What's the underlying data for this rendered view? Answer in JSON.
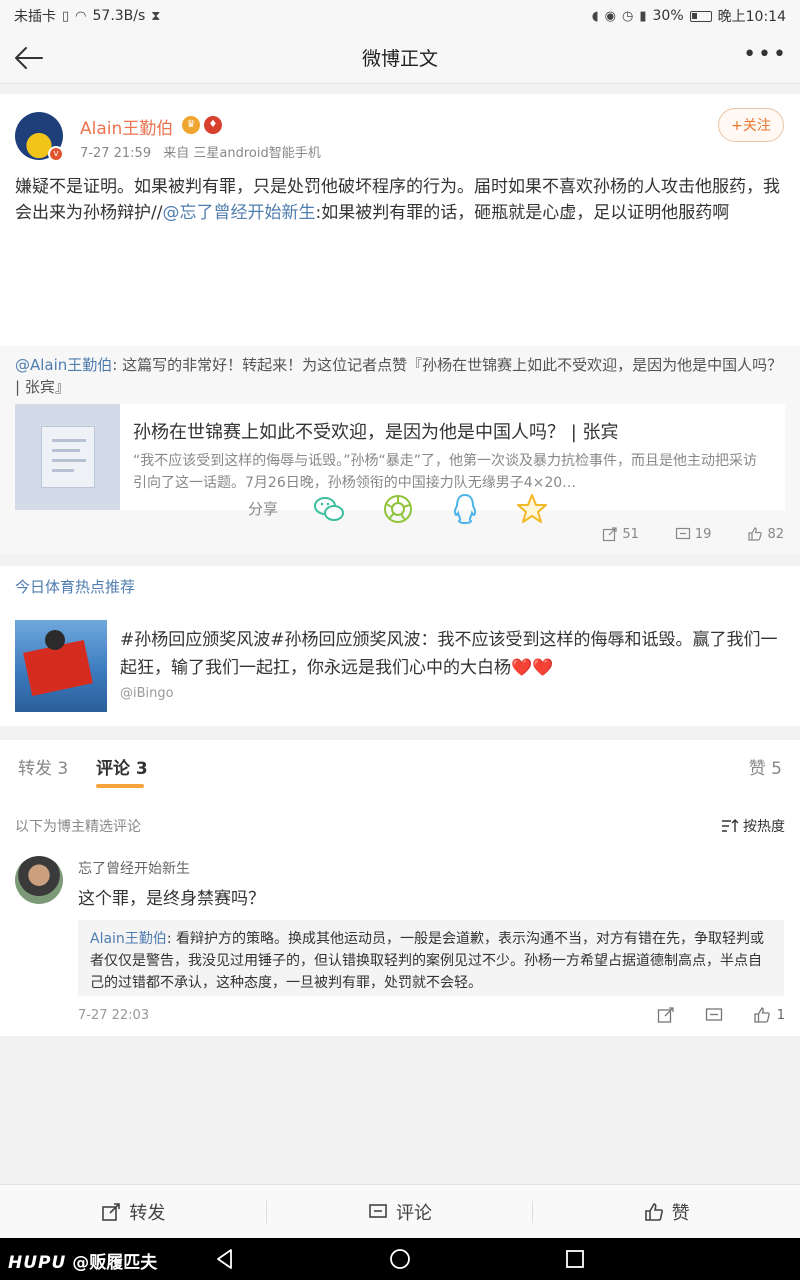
{
  "status_bar": {
    "sim": "未插卡",
    "speed": "57.3B/s",
    "battery_text": "30%",
    "battery_level": 0.3,
    "time": "晚上10:14"
  },
  "nav": {
    "title": "微博正文"
  },
  "post": {
    "username": "Alain王勤伯",
    "time": "7-27 21:59",
    "source": "来自 三星android智能手机",
    "follow_label": "+关注",
    "text_before": "嫌疑不是证明。如果被判有罪，只是处罚他破坏程序的行为。届时如果不喜欢孙杨的人攻击他服药，我会出来为孙杨辩护//",
    "mention": "@忘了曾经开始新生",
    "text_after": ":如果被判有罪的话，砸瓶就是心虚，足以证明他服药啊"
  },
  "repost": {
    "mention": "@Alain王勤伯",
    "text": ": 这篇写的非常好！转起来！为这位记者点赞『孙杨在世锦赛上如此不受欢迎，是因为他是中国人吗？ | 张宾』",
    "card_title": "孙杨在世锦赛上如此不受欢迎，是因为他是中国人吗？ | 张宾",
    "card_desc": "“我不应该受到这样的侮辱与诋毁。”孙杨“暴走”了，他第一次谈及暴力抗检事件，而且是他主动把采访引向了这一话题。7月26日晚，孙杨领衔的中国接力队无缘男子4×20…",
    "reposts": "51",
    "comments": "19",
    "likes": "82"
  },
  "share": {
    "label": "分享"
  },
  "hot": {
    "header": "今日体育热点推荐",
    "text": "#孙杨回应颁奖风波#孙杨回应颁奖风波：我不应该受到这样的侮辱和诋毁。赢了我们一起狂，输了我们一起扛，你永远是我们心中的大白杨❤️❤️",
    "source": "@iBingo"
  },
  "comments": {
    "tab_repost": "转发 3",
    "tab_comment": "评论 3",
    "tab_like": "赞 5",
    "selected_label": "以下为博主精选评论",
    "sort_label": "按热度",
    "user": "忘了曾经开始新生",
    "text": "这个罪，是终身禁赛吗？",
    "reply_user": "Alain王勤伯",
    "reply_text": ": 看辩护方的策略。换成其他运动员，一般是会道歉，表示沟通不当，对方有错在先，争取轻判或者仅仅是警告，我没见过用锤子的，但认错换取轻判的案例见过不少。孙杨一方希望占据道德制高点，半点自己的过错都不承认，这种态度，一旦被判有罪，处罚就不会轻。",
    "time": "7-27 22:03",
    "like_count": "1"
  },
  "bottom_bar": {
    "repost": "转发",
    "comment": "评论",
    "like": "赞"
  },
  "watermark": {
    "brand": "HUPU",
    "handle": "@贩履匹夫"
  },
  "colors": {
    "accent_orange": "#eb7350",
    "link_blue": "#507daf",
    "tab_underline": "#f7a33b"
  }
}
